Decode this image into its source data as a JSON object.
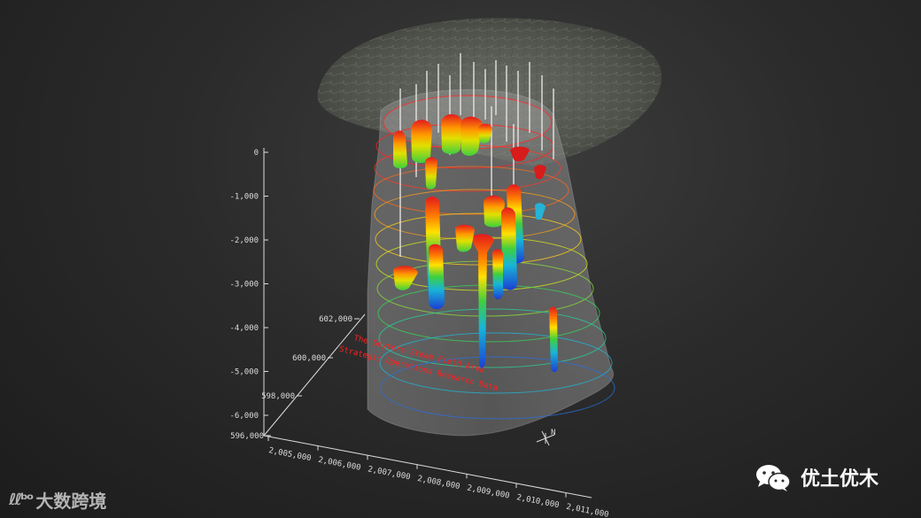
{
  "z_axis": {
    "ticks": [
      "0",
      "-1,000",
      "-2,000",
      "-3,000",
      "-4,000",
      "-5,000",
      "-6,000"
    ]
  },
  "y_axis": {
    "ticks": [
      "602,000",
      "600,000",
      "598,000",
      "596,000"
    ]
  },
  "x_axis": {
    "ticks": [
      "2,005,000",
      "2,006,000",
      "2,007,000",
      "2,008,000",
      "2,009,000",
      "2,010,000",
      "2,011,000"
    ]
  },
  "title": {
    "line1": "The Geysers Steam Field Area",
    "line2": "Strategic Operations Research Data"
  },
  "compass": {
    "label": "N"
  },
  "watermark_left": {
    "logo": "ℓℓᵇᵒ",
    "text": "大数跨境"
  },
  "watermark_right": {
    "text": "优土优木"
  },
  "colors": {
    "background": "#2a2a2a",
    "axis": "#dcdcdc",
    "title": "#ff2020",
    "volume": "#9a9a9a"
  }
}
